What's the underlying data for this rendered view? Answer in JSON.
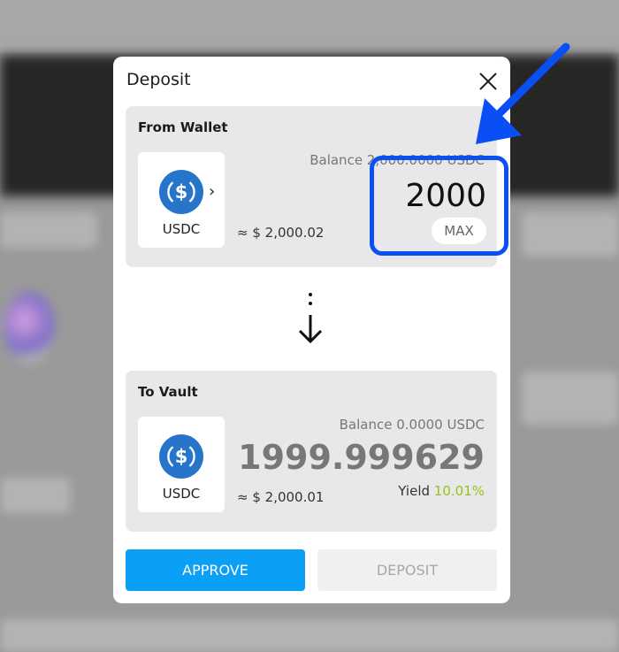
{
  "modal": {
    "title": "Deposit"
  },
  "from": {
    "label": "From Wallet",
    "token": "USDC",
    "balance": "Balance 2,000.0000 USDC",
    "amount": "2000",
    "max_label": "MAX",
    "usd_value": "≈ $ 2,000.02"
  },
  "to": {
    "label": "To Vault",
    "token": "USDC",
    "balance": "Balance 0.0000 USDC",
    "amount": "1999.999629",
    "usd_value": "≈ $ 2,000.01",
    "yield_label": "Yield",
    "yield_value": "10.01%"
  },
  "actions": {
    "approve_label": "APPROVE",
    "deposit_label": "DEPOSIT"
  },
  "icons": {
    "close": "close-icon",
    "token": "usdc-icon",
    "chevron": "chevron-right-icon",
    "flow": "arrow-down-icon"
  },
  "colors": {
    "primary": "#0b9ff5",
    "usdc": "#2775ca",
    "yield": "#97c11a",
    "highlight": "#0a4ff5"
  }
}
